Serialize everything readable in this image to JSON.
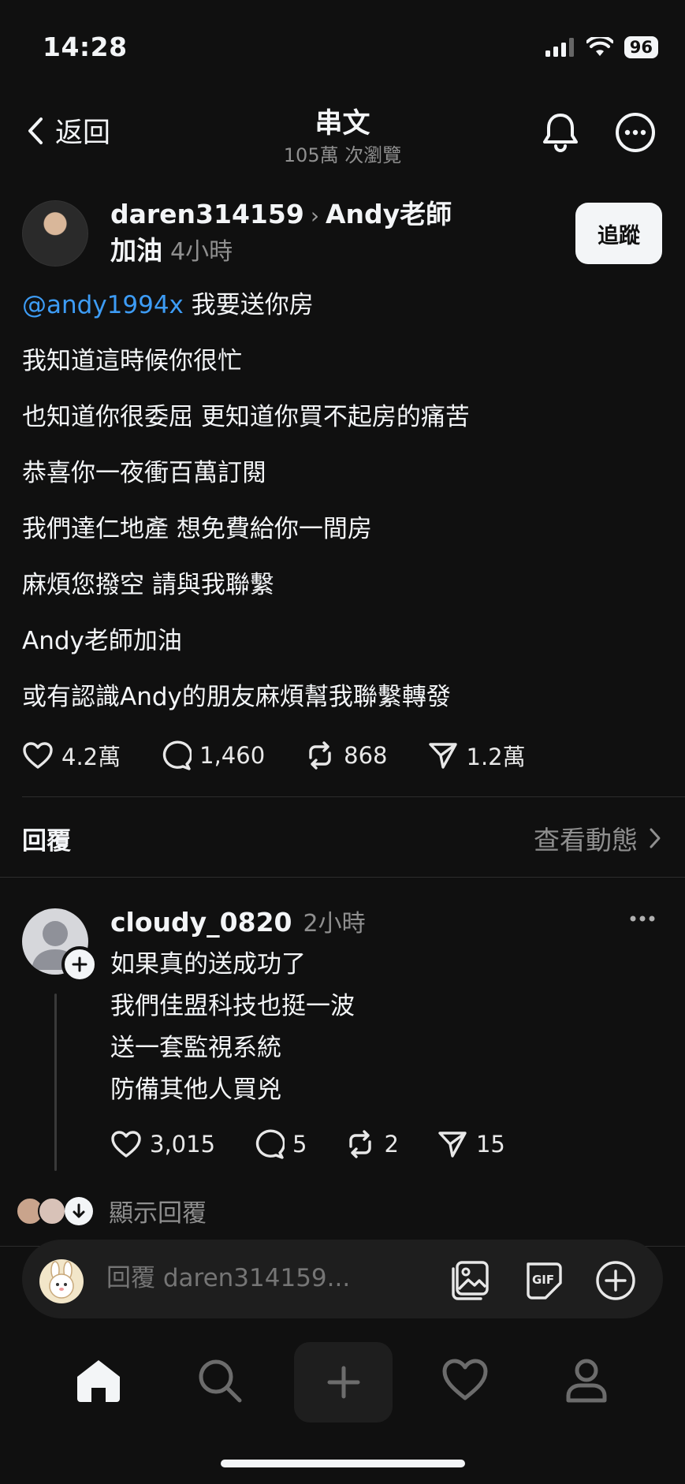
{
  "status_bar": {
    "time": "14:28",
    "battery": "96"
  },
  "header": {
    "back_label": "返回",
    "title": "串文",
    "views": "105萬 次瀏覽"
  },
  "post": {
    "author": "daren314159",
    "reply_to": "Andy老師加油",
    "time": "4小時",
    "follow_label": "追蹤",
    "mention": "@andy1994x",
    "lines": [
      "我要送你房",
      "我知道這時候你很忙",
      "也知道你很委屈 更知道你買不起房的痛苦",
      "恭喜你一夜衝百萬訂閱",
      "我們達仁地產 想免費給你一間房",
      "麻煩您撥空 請與我聯繫",
      "Andy老師加油",
      "或有認識Andy的朋友麻煩幫我聯繫轉發"
    ],
    "stats": {
      "likes": "4.2萬",
      "comments": "1,460",
      "reposts": "868",
      "shares": "1.2萬"
    }
  },
  "replies_section": {
    "label": "回覆",
    "activity_link": "查看動態"
  },
  "reply": {
    "author": "cloudy_0820",
    "time": "2小時",
    "lines": [
      "如果真的送成功了",
      "我們佳盟科技也挺一波",
      "送一套監視系統",
      "防備其他人買兇"
    ],
    "stats": {
      "likes": "3,015",
      "comments": "5",
      "reposts": "2",
      "shares": "15"
    },
    "show_replies_label": "顯示回覆"
  },
  "composer": {
    "placeholder": "回覆 daren314159..."
  },
  "icons": {
    "back": "chevron-left-icon",
    "bell": "bell-icon",
    "more": "more-circle-icon",
    "like": "heart-icon",
    "comment": "comment-icon",
    "repost": "repost-icon",
    "share": "send-icon",
    "gallery": "image-icon",
    "gif": "gif-icon",
    "add": "plus-circle-icon",
    "home": "home-icon",
    "search": "search-icon",
    "create": "plus-icon",
    "activity": "heart-icon",
    "profile": "profile-icon"
  },
  "colors": {
    "background": "#101010",
    "mention": "#3d9cf5",
    "muted": "#8f8f8f",
    "text": "#f3f5f7"
  }
}
